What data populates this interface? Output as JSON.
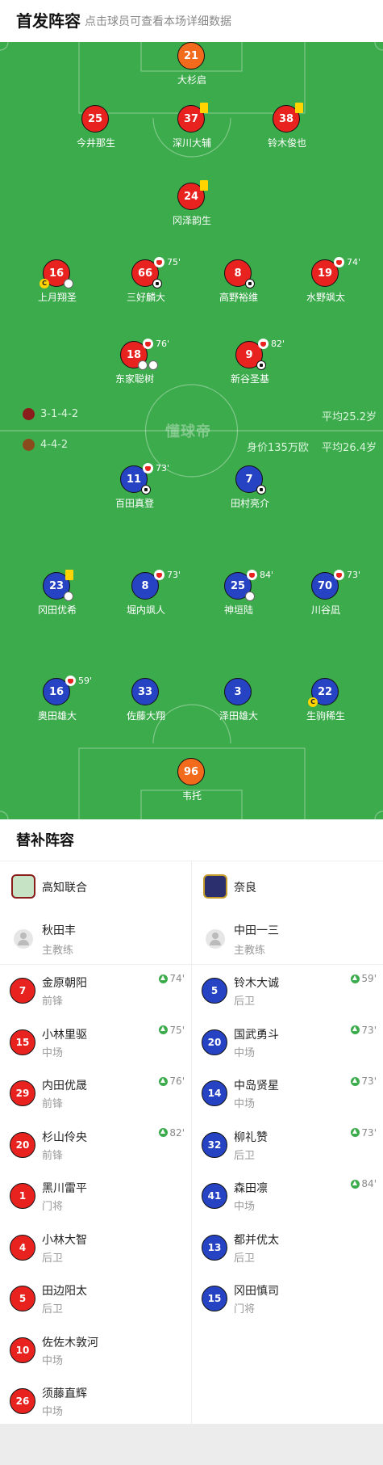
{
  "header": {
    "title": "首发阵容",
    "subtitle": "点击球员可查看本场详细数据"
  },
  "pitch": {
    "watermark": "懂球帝",
    "home_team": {
      "formation": "3-1-4-2",
      "avg_age": "平均25.2岁",
      "logo_color": "#8a1c1c"
    },
    "away_team": {
      "formation": "4-4-2",
      "value": "身价135万欧",
      "avg_age": "平均26.4岁",
      "logo_color": "#8a4b1c"
    }
  },
  "players": [
    {
      "num": "21",
      "name": "大杉启",
      "team": "gk"
    },
    {
      "num": "25",
      "name": "今井那生",
      "team": "home"
    },
    {
      "num": "37",
      "name": "深川大辅",
      "team": "home"
    },
    {
      "num": "38",
      "name": "铃木俊也",
      "team": "home"
    },
    {
      "num": "24",
      "name": "冈泽韵生",
      "team": "home"
    },
    {
      "num": "16",
      "name": "上月翔圣",
      "team": "home"
    },
    {
      "num": "66",
      "name": "三好麟大",
      "team": "home",
      "sub_time": "75'"
    },
    {
      "num": "8",
      "name": "高野裕维",
      "team": "home"
    },
    {
      "num": "19",
      "name": "水野飒太",
      "team": "home",
      "sub_time": "74'"
    },
    {
      "num": "18",
      "name": "东家聪树",
      "team": "home",
      "sub_time": "76'"
    },
    {
      "num": "9",
      "name": "新谷圣基",
      "team": "home",
      "sub_time": "82'"
    },
    {
      "num": "11",
      "name": "百田真登",
      "team": "away",
      "sub_time": "73'"
    },
    {
      "num": "7",
      "name": "田村亮介",
      "team": "away"
    },
    {
      "num": "23",
      "name": "冈田优希",
      "team": "away"
    },
    {
      "num": "8",
      "name": "堀内飒人",
      "team": "away",
      "sub_time": "73'"
    },
    {
      "num": "25",
      "name": "神垣陆",
      "team": "away",
      "sub_time": "84'"
    },
    {
      "num": "70",
      "name": "川谷凪",
      "team": "away",
      "sub_time": "73'"
    },
    {
      "num": "16",
      "name": "奥田雄大",
      "team": "away",
      "sub_time": "59'"
    },
    {
      "num": "33",
      "name": "佐藤大翔",
      "team": "away"
    },
    {
      "num": "3",
      "name": "泽田雄大",
      "team": "away"
    },
    {
      "num": "22",
      "name": "生驹稀生",
      "team": "away"
    },
    {
      "num": "96",
      "name": "韦托",
      "team": "gk"
    }
  ],
  "substitutes": {
    "title": "替补阵容",
    "home": {
      "team_name": "高知联合",
      "coach_name": "秋田丰",
      "coach_role": "主教练",
      "players": [
        {
          "num": "7",
          "name": "金原朝阳",
          "pos": "前锋",
          "on": "74'"
        },
        {
          "num": "15",
          "name": "小林里驱",
          "pos": "中场",
          "on": "75'"
        },
        {
          "num": "29",
          "name": "内田优晟",
          "pos": "前锋",
          "on": "76'"
        },
        {
          "num": "20",
          "name": "杉山伶央",
          "pos": "前锋",
          "on": "82'"
        },
        {
          "num": "1",
          "name": "黑川雷平",
          "pos": "门将",
          "on": ""
        },
        {
          "num": "4",
          "name": "小林大智",
          "pos": "后卫",
          "on": ""
        },
        {
          "num": "5",
          "name": "田边阳太",
          "pos": "后卫",
          "on": ""
        },
        {
          "num": "10",
          "name": "佐佐木敦河",
          "pos": "中场",
          "on": ""
        },
        {
          "num": "26",
          "name": "须藤直辉",
          "pos": "中场",
          "on": ""
        }
      ]
    },
    "away": {
      "team_name": "奈良",
      "coach_name": "中田一三",
      "coach_role": "主教练",
      "players": [
        {
          "num": "5",
          "name": "铃木大诚",
          "pos": "后卫",
          "on": "59'"
        },
        {
          "num": "20",
          "name": "国武勇斗",
          "pos": "中场",
          "on": "73'"
        },
        {
          "num": "14",
          "name": "中岛贤星",
          "pos": "中场",
          "on": "73'"
        },
        {
          "num": "32",
          "name": "柳礼赞",
          "pos": "后卫",
          "on": "73'"
        },
        {
          "num": "41",
          "name": "森田凛",
          "pos": "中场",
          "on": "84'"
        },
        {
          "num": "13",
          "name": "都并优太",
          "pos": "后卫",
          "on": ""
        },
        {
          "num": "15",
          "name": "冈田慎司",
          "pos": "门将",
          "on": ""
        }
      ]
    }
  },
  "colors": {
    "home": "#e8231f",
    "away": "#2643c3",
    "gk": "#f26a1b",
    "pitch": "#3cab4c",
    "yellow_card": "#ffd400"
  }
}
